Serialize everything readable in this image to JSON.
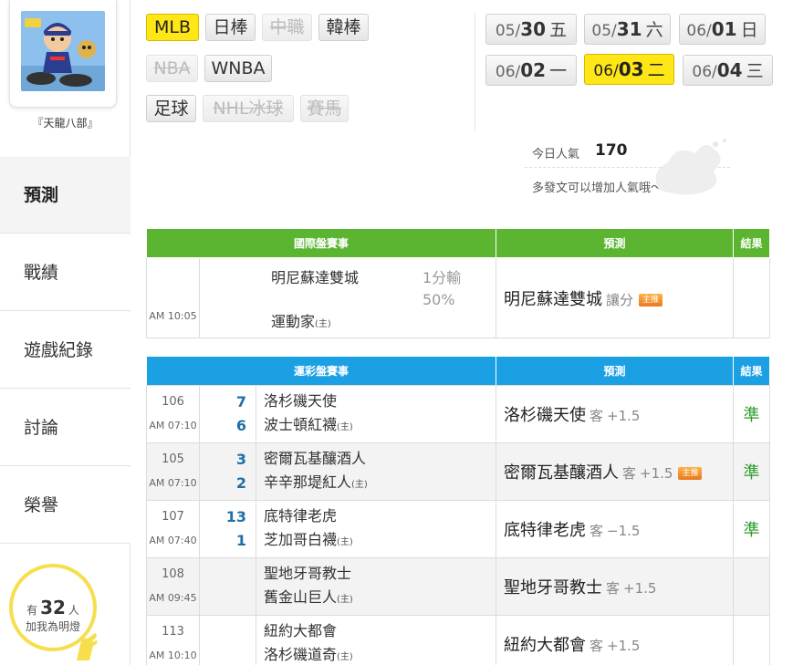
{
  "user": {
    "name": "『天龍八部』"
  },
  "sidebar": {
    "items": [
      {
        "label": "預測",
        "active": true
      },
      {
        "label": "戰績"
      },
      {
        "label": "遊戲紀錄"
      },
      {
        "label": "討論"
      },
      {
        "label": "榮譽"
      }
    ],
    "fans": {
      "prefix": "有",
      "count": "32",
      "suffix": "人",
      "line2": "加我為明燈"
    }
  },
  "sports": {
    "items": [
      {
        "label": "MLB",
        "state": "selected"
      },
      {
        "label": "日棒",
        "state": "normal"
      },
      {
        "label": "中職",
        "state": "disabled"
      },
      {
        "label": "韓棒",
        "state": "normal"
      },
      {
        "label": "NBA",
        "state": "disabled"
      },
      {
        "label": "WNBA",
        "state": "normal"
      },
      {
        "label": "足球",
        "state": "normal"
      },
      {
        "label": "NHL冰球",
        "state": "disabled"
      },
      {
        "label": "賽馬",
        "state": "disabled"
      }
    ]
  },
  "dates": {
    "items": [
      {
        "month": "05/",
        "day": "30",
        "weekday": "五"
      },
      {
        "month": "05/",
        "day": "31",
        "weekday": "六"
      },
      {
        "month": "06/",
        "day": "01",
        "weekday": "日"
      },
      {
        "month": "06/",
        "day": "02",
        "weekday": "一"
      },
      {
        "month": "06/",
        "day": "03",
        "weekday": "二",
        "selected": true
      },
      {
        "month": "06/",
        "day": "04",
        "weekday": "三"
      }
    ]
  },
  "popularity": {
    "label": "今日人氣",
    "value": "170",
    "tip": "多發文可以增加人氣哦～"
  },
  "intl": {
    "headers": {
      "event": "國際盤賽事",
      "pred": "預測",
      "result": "結果"
    },
    "rows": [
      {
        "time": "AM 10:05",
        "team1": "明尼蘇達雙城",
        "team2": "運動家",
        "home_mark": "(主)",
        "line": "1分輸",
        "pct": "50%",
        "pred_team": "明尼蘇達雙城",
        "pred_side": "讓分",
        "badge": "主推",
        "result": ""
      }
    ]
  },
  "lottery": {
    "headers": {
      "event": "運彩盤賽事",
      "pred": "預測",
      "result": "結果"
    },
    "rows": [
      {
        "num": "106",
        "time": "AM 07:10",
        "s1": "7",
        "s2": "6",
        "team1": "洛杉磯天使",
        "team2": "波士頓紅襪",
        "home_mark": "(主)",
        "pred_team": "洛杉磯天使",
        "pred_side": "客",
        "odds": "+1.5",
        "badge": "",
        "result": "準"
      },
      {
        "num": "105",
        "time": "AM 07:10",
        "s1": "3",
        "s2": "2",
        "team1": "密爾瓦基釀酒人",
        "team2": "辛辛那堤紅人",
        "home_mark": "(主)",
        "pred_team": "密爾瓦基釀酒人",
        "pred_side": "客",
        "odds": "+1.5",
        "badge": "主推",
        "result": "準"
      },
      {
        "num": "107",
        "time": "AM 07:40",
        "s1": "13",
        "s2": "1",
        "team1": "底特律老虎",
        "team2": "芝加哥白襪",
        "home_mark": "(主)",
        "pred_team": "底特律老虎",
        "pred_side": "客",
        "odds": "−1.5",
        "badge": "",
        "result": "準"
      },
      {
        "num": "108",
        "time": "AM 09:45",
        "s1": "",
        "s2": "",
        "team1": "聖地牙哥教士",
        "team2": "舊金山巨人",
        "home_mark": "(主)",
        "pred_team": "聖地牙哥教士",
        "pred_side": "客",
        "odds": "+1.5",
        "badge": "",
        "result": ""
      },
      {
        "num": "113",
        "time": "AM 10:10",
        "s1": "",
        "s2": "",
        "team1": "紐約大都會",
        "team2": "洛杉磯道奇",
        "home_mark": "(主)",
        "pred_team": "紐約大都會",
        "pred_side": "客",
        "odds": "+1.5",
        "badge": "",
        "result": ""
      }
    ]
  },
  "colors": {
    "accent_yellow": "#ffe616",
    "intl_green": "#5bb531",
    "lottery_blue": "#1ca0e4",
    "hit_green": "#2a9b2a",
    "score_blue": "#1f6fa8"
  }
}
